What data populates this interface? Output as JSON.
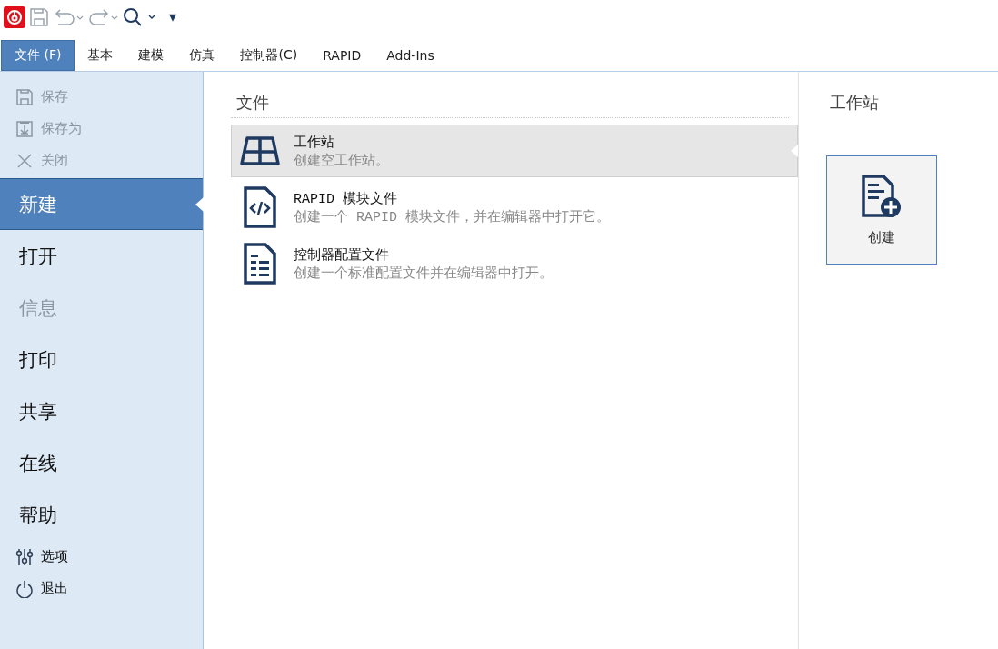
{
  "quick_access": {
    "customize_label": "▾"
  },
  "tabs": [
    {
      "label": "文件 (F)",
      "selected": true
    },
    {
      "label": "基本",
      "selected": false
    },
    {
      "label": "建模",
      "selected": false
    },
    {
      "label": "仿真",
      "selected": false
    },
    {
      "label": "控制器(C)",
      "selected": false
    },
    {
      "label": "RAPID",
      "selected": false
    },
    {
      "label": "Add-Ins",
      "selected": false
    }
  ],
  "sidebar": {
    "top_items": [
      {
        "label": "保存",
        "kind": "save",
        "disabled": true
      },
      {
        "label": "保存为",
        "kind": "saveas",
        "disabled": true
      },
      {
        "label": "关闭",
        "kind": "close",
        "disabled": true
      }
    ],
    "pages": [
      {
        "label": "新建",
        "selected": true,
        "disabled": false
      },
      {
        "label": "打开",
        "selected": false,
        "disabled": false
      },
      {
        "label": "信息",
        "selected": false,
        "disabled": true
      },
      {
        "label": "打印",
        "selected": false,
        "disabled": false
      },
      {
        "label": "共享",
        "selected": false,
        "disabled": false
      },
      {
        "label": "在线",
        "selected": false,
        "disabled": false
      },
      {
        "label": "帮助",
        "selected": false,
        "disabled": false
      }
    ],
    "bottom_items": [
      {
        "label": "选项",
        "kind": "options",
        "disabled": false
      },
      {
        "label": "退出",
        "kind": "exit",
        "disabled": false
      }
    ]
  },
  "files": {
    "title": "文件",
    "items": [
      {
        "kind": "workstation",
        "title": "工作站",
        "description": "创建空工作站。",
        "selected": true
      },
      {
        "kind": "module",
        "title": "RAPID 模块文件",
        "description": "创建一个 RAPID 模块文件，并在编辑器中打开它。",
        "selected": false
      },
      {
        "kind": "config",
        "title": "控制器配置文件",
        "description": "创建一个标准配置文件并在编辑器中打开。",
        "selected": false
      }
    ]
  },
  "detail": {
    "title": "工作站",
    "create_button": "创建"
  }
}
